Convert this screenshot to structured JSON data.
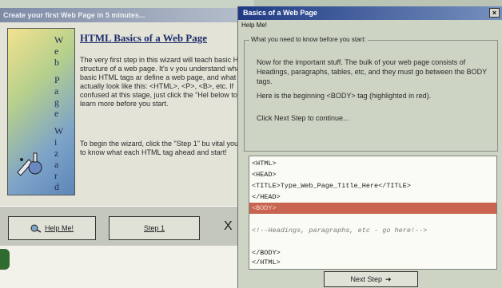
{
  "wizard": {
    "title": "Create your first Web Page in 5 minutes...",
    "banner_letters": [
      "W",
      "e",
      "b",
      "P",
      "a",
      "g",
      "e",
      "W",
      "i",
      "z",
      "a",
      "r",
      "d"
    ],
    "heading": "HTML Basics of a Web Page",
    "para1": "The very first step in this wizard will teach basic HTML structure of a web page. It's v you understand what basic HTML tags ar define a web page, and what they actually look like this: <HTML>, <P>, <B>, etc. If confused at this stage, just click the \"Hel below to learn more before you start.",
    "para2": "To begin the wizard, click the \"Step 1\" bu vital you get to know what each HTML tag ahead and start!",
    "help_button": "Help Me!",
    "step_button": "Step 1",
    "close_glyph": "X"
  },
  "basics": {
    "title": "Basics of a Web Page",
    "close_glyph": "×",
    "menu": "Help Me!",
    "group_label": "What you need to know before you start:",
    "text1": "Now for the important stuff. The bulk of your web page consists of Headings, paragraphs, tables, etc, and they must go between the BODY tags.",
    "text2": "Here is the beginning <BODY> tag (highlighted in red).",
    "text3": "Click Next Step to continue...",
    "code_lines": [
      {
        "text": "<HTML>"
      },
      {
        "text": "<HEAD>"
      },
      {
        "text": "<TITLE>Type_Web_Page_Title_Here</TITLE>"
      },
      {
        "text": "</HEAD>"
      },
      {
        "text": "<BODY>"
      },
      {
        "text": ""
      },
      {
        "text": "<!--Headings, paragraphs, etc - go here!-->"
      },
      {
        "text": ""
      },
      {
        "text": "</BODY>"
      },
      {
        "text": "</HTML>"
      }
    ],
    "next_button": "Next Step",
    "next_arrow": "➔"
  },
  "colors": {
    "highlight": "#c8644f",
    "title_active": "#1f3a84"
  }
}
